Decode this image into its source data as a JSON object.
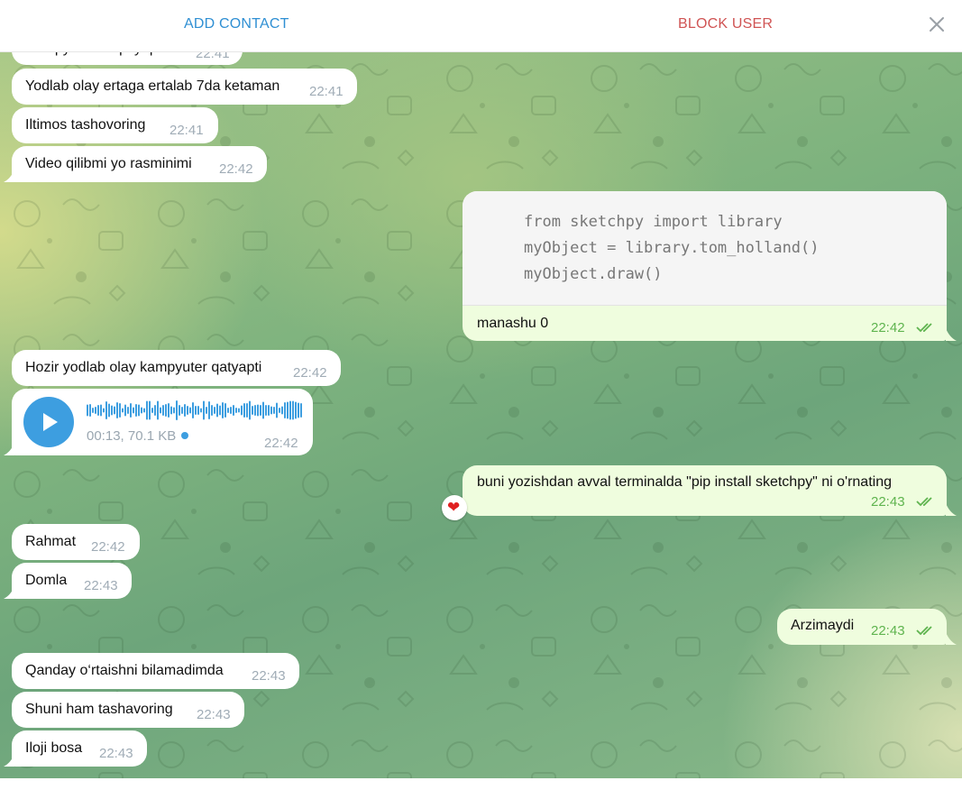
{
  "header": {
    "add_contact_label": "ADD CONTACT",
    "block_user_label": "BLOCK USER",
    "close_icon": "close-icon"
  },
  "colors": {
    "accent": "#2f8fd3",
    "danger": "#d05454",
    "outgoing_bubble": "#effdde",
    "incoming_bubble": "#ffffff",
    "outgoing_time": "#5fb44f",
    "play_button": "#3d9ee0"
  },
  "messages": {
    "m0": {
      "text": "Kampyuterim qatyapti",
      "time": "22:41",
      "direction": "in"
    },
    "m1": {
      "text": "Yodlab olay ertaga ertalab 7da ketaman",
      "time": "22:41",
      "direction": "in"
    },
    "m2": {
      "text": "Iltimos tashovoring",
      "time": "22:41",
      "direction": "in"
    },
    "m3": {
      "text": "Video qilibmi yo rasminimi",
      "time": "22:42",
      "direction": "in"
    },
    "m4": {
      "direction": "out",
      "code": [
        "from sketchpy import library",
        "myObject = library.tom_holland()",
        "myObject.draw()"
      ],
      "caption": "manashu 0",
      "time": "22:42",
      "status": "read"
    },
    "m5": {
      "text": "Hozir yodlab olay kampyuter qatyapti",
      "time": "22:42",
      "direction": "in"
    },
    "m6": {
      "direction": "in",
      "type": "voice",
      "duration": "00:13",
      "size": "70.1 KB",
      "meta": "00:13, 70.1 KB",
      "time": "22:42",
      "unplayed": true
    },
    "m7": {
      "text": "buni yozishdan avval terminalda \"pip install sketchpy\" ni o'rnating",
      "time": "22:43",
      "direction": "out",
      "status": "read",
      "reaction": "❤"
    },
    "m8": {
      "text": "Rahmat",
      "time": "22:42",
      "direction": "in"
    },
    "m9": {
      "text": "Domla",
      "time": "22:43",
      "direction": "in"
    },
    "m10": {
      "text": "Arzimaydi",
      "time": "22:43",
      "direction": "out",
      "status": "read"
    },
    "m11": {
      "text": "Qanday o‘rtaishni bilamadimda",
      "time": "22:43",
      "direction": "in"
    },
    "m12": {
      "text": "Shuni ham tashavoring",
      "time": "22:43",
      "direction": "in"
    },
    "m13": {
      "text": "Iloji bosa",
      "time": "22:43",
      "direction": "in"
    }
  }
}
